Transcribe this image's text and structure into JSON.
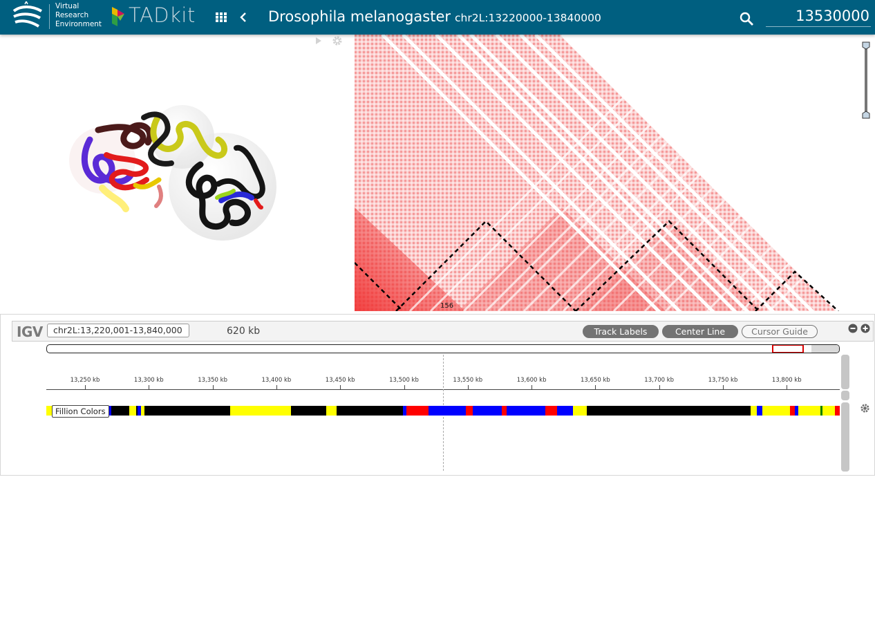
{
  "header": {
    "vre_lines": [
      "Virtual",
      "Research",
      "Environment"
    ],
    "tadkit_logo_text": "TADkit",
    "species": "Drosophila melanogaster",
    "region": "chr2L:13220000-13840000",
    "position_value": "13530000"
  },
  "matrix": {
    "index_label": "156"
  },
  "igv": {
    "logo": "IGV",
    "locus": "chr2L:13,220,001-13,840,000",
    "width_label": "620 kb",
    "buttons": {
      "track_labels": "Track Labels",
      "center_line": "Center Line",
      "cursor_guide": "Cursor Guide"
    },
    "ruler_ticks": [
      "13,250 kb",
      "13,300 kb",
      "13,350 kb",
      "13,400 kb",
      "13,450 kb",
      "13,500 kb",
      "13,550 kb",
      "13,600 kb",
      "13,650 kb",
      "13,700 kb",
      "13,750 kb",
      "13,800 kb"
    ],
    "track_name": "Fillion Colors"
  },
  "colors": {
    "header_bg": "#005f80",
    "chromatin_yellow": "#ffff00",
    "chromatin_black": "#000000",
    "chromatin_blue": "#0000ff",
    "chromatin_red": "#ff0000",
    "chromatin_green": "#008000",
    "matrix_red": "#f03030"
  },
  "icons": [
    "vre-logo-icon",
    "tadkit-logo-icon",
    "apps-grid-icon",
    "chevron-left-icon",
    "search-icon",
    "play-icon",
    "gear-icon",
    "zoom-out-icon",
    "zoom-in-icon"
  ]
}
